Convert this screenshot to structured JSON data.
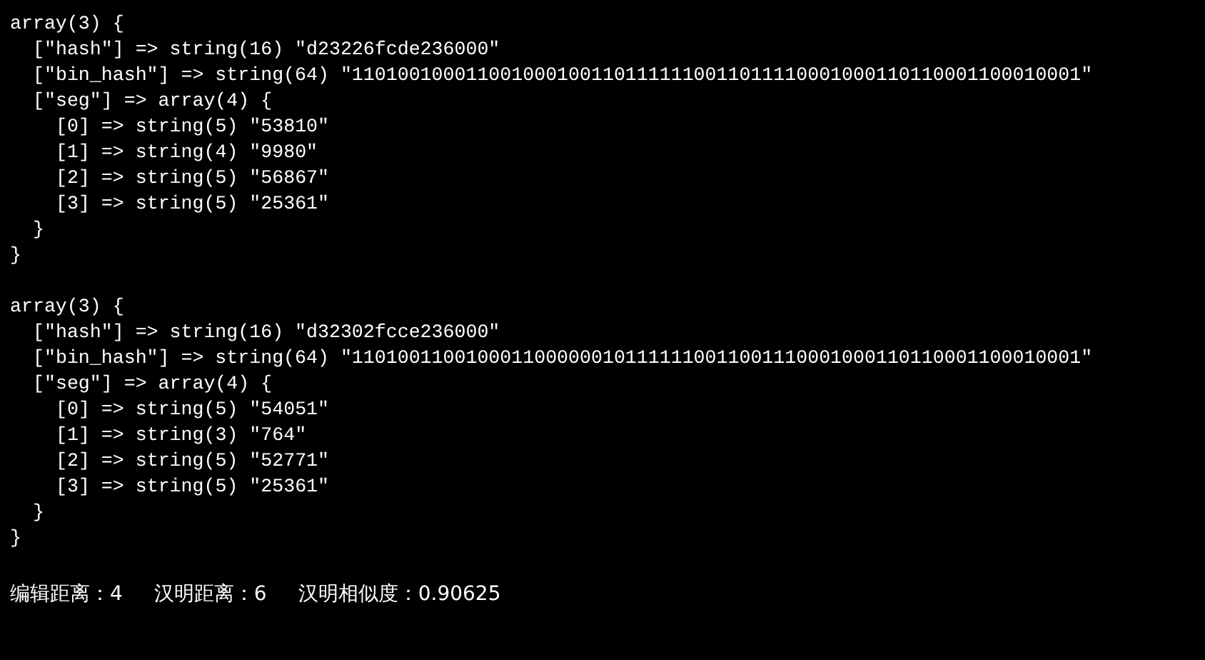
{
  "dumps": [
    {
      "open": "array(3) {",
      "close": "}",
      "children": [
        {
          "text": "[\"hash\"] => string(16) \"d23226fcde236000\""
        },
        {
          "text": "[\"bin_hash\"] => string(64) \"1101001000110010001001101111110011011110001000110110001100010001\""
        },
        {
          "open": "[\"seg\"] => array(4) {",
          "close": "}",
          "children": [
            {
              "text": "[0] => string(5) \"53810\""
            },
            {
              "text": "[1] => string(4) \"9980\""
            },
            {
              "text": "[2] => string(5) \"56867\""
            },
            {
              "text": "[3] => string(5) \"25361\""
            }
          ]
        }
      ]
    },
    {
      "open": "array(3) {",
      "close": "}",
      "children": [
        {
          "text": "[\"hash\"] => string(16) \"d32302fcce236000\""
        },
        {
          "text": "[\"bin_hash\"] => string(64) \"1101001100100011000000101111110011001110001000110110001100010001\""
        },
        {
          "open": "[\"seg\"] => array(4) {",
          "close": "}",
          "children": [
            {
              "text": "[0] => string(5) \"54051\""
            },
            {
              "text": "[1] => string(3) \"764\""
            },
            {
              "text": "[2] => string(5) \"52771\""
            },
            {
              "text": "[3] => string(5) \"25361\""
            }
          ]
        }
      ]
    }
  ],
  "summary": [
    "编辑距离：4",
    "汉明距离：6",
    "汉明相似度：0.90625"
  ]
}
